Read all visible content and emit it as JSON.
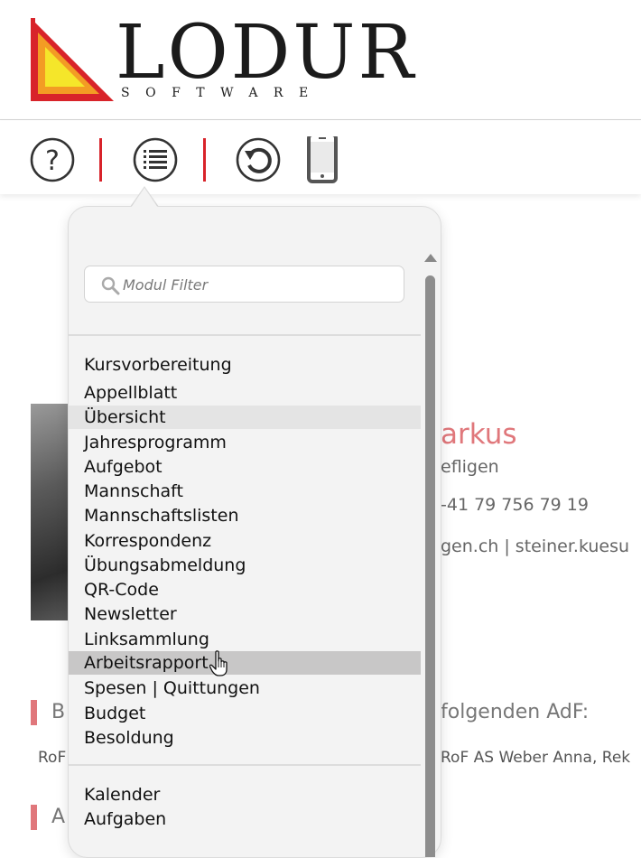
{
  "logo": {
    "word": "LODUR",
    "sub": "SOFTWARE"
  },
  "toolbar": {
    "icons": [
      "help-icon",
      "list-menu-icon",
      "undo-icon",
      "mobile-icon"
    ],
    "separator_color": "#d8232a"
  },
  "background": {
    "person_name": "arkus",
    "line1": "efligen",
    "line2": "-41 79 756 79 19",
    "line3": "gen.ch | steiner.kuesu",
    "section1_left": "B",
    "section1_right": "folgenden AdF:",
    "small_left": "RoF",
    "small_right": "RoF AS Weber Anna, Rek",
    "section2_left": "A"
  },
  "menu": {
    "filter_placeholder": "Modul Filter",
    "group1": [
      "Kursvorbereitung",
      "Appellblatt",
      "Übersicht",
      "Jahresprogramm",
      "Aufgebot",
      "Mannschaft",
      "Mannschaftslisten",
      "Korrespondenz",
      "Übungsabmeldung",
      "QR-Code",
      "Newsletter",
      "Linksammlung",
      "Arbeitsrapport",
      "Spesen | Quittungen",
      "Budget",
      "Besoldung"
    ],
    "group2": [
      "Kalender",
      "Aufgaben"
    ],
    "highlight_color_selected": "#e4e4e4",
    "highlight_color_hover": "#c8c7c7"
  },
  "colors": {
    "accent": "#e0777b",
    "logo_red": "#d8232a",
    "logo_yellow": "#f5e62a",
    "logo_orange": "#f39c24"
  }
}
